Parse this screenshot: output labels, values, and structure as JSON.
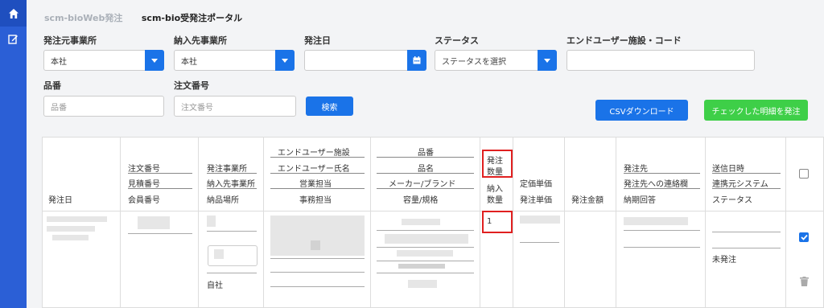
{
  "nav": {
    "home_icon": "home-icon",
    "edit_icon": "edit-icon"
  },
  "breadcrumb": {
    "app": "scm-bioWeb発注",
    "page": "scm-bio受発注ポータル"
  },
  "filters": {
    "orderer_office": {
      "label": "発注元事業所",
      "value": "本社"
    },
    "delivery_office": {
      "label": "納入先事業所",
      "value": "本社"
    },
    "order_date": {
      "label": "発注日",
      "value": ""
    },
    "status": {
      "label": "ステータス",
      "placeholder": "ステータスを選択"
    },
    "enduser_code": {
      "label": "エンドユーザー施設・コード",
      "value": ""
    },
    "product": {
      "label": "品番",
      "placeholder": "品番"
    },
    "order_no": {
      "label": "注文番号",
      "placeholder": "注文番号"
    }
  },
  "buttons": {
    "search": "検索",
    "csv_download": "CSVダウンロード",
    "order_checked": "チェックした明細を発注"
  },
  "table": {
    "headers": {
      "order_date": "発注日",
      "order_no": "注文番号",
      "estimate_no": "見積番号",
      "member_no": "会員番号",
      "orderer_office": "発注事業所",
      "delivery_office": "納入先事業所",
      "delivery_place": "納品場所",
      "enduser_facility": "エンドユーザー施設",
      "enduser_name": "エンドユーザー氏名",
      "sales_rep": "営業担当",
      "office_rep": "事務担当",
      "item_no": "品番",
      "item_name": "品名",
      "maker_brand": "メーカー/ブランド",
      "capacity_spec": "容量/規格",
      "order_qty_1": "発注",
      "order_qty_2": "数量",
      "delivery_qty_1": "納入",
      "delivery_qty_2": "数量",
      "list_price": "定価単価",
      "order_price": "発注単価",
      "order_amount": "発注金額",
      "supplier": "発注先",
      "supplier_contact": "発注先への連絡欄",
      "delivery_reply": "納期回答",
      "sent_at": "送信日時",
      "linked_system": "連携元システム",
      "status": "ステータス"
    },
    "row": {
      "delivery_place": "自社",
      "order_qty": "1",
      "status": "未発注",
      "checked": true
    }
  },
  "colors": {
    "primary": "#1a73e8",
    "success": "#3ecf48",
    "sidebar": "#2b5fd6",
    "highlight": "#e02020"
  }
}
